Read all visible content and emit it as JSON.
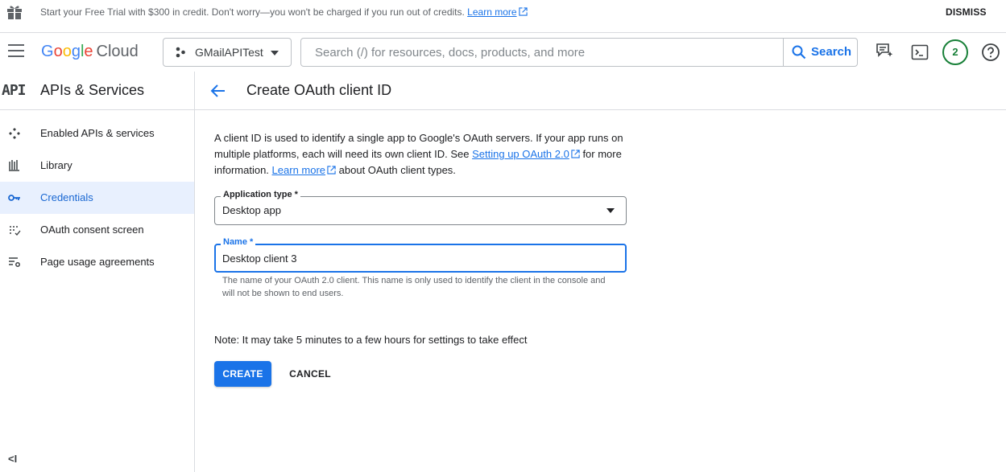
{
  "banner": {
    "message": "Start your Free Trial with $300 in credit. Don't worry—you won't be charged if you run out of credits.",
    "learn_more": "Learn more",
    "dismiss": "DISMISS"
  },
  "topbar": {
    "logo_google": [
      "G",
      "o",
      "o",
      "g",
      "l",
      "e"
    ],
    "logo_cloud": "Cloud",
    "project_name": "GMailAPITest",
    "search_placeholder": "Search (/) for resources, docs, products, and more",
    "search_button": "Search",
    "notification_count": "2"
  },
  "sidebar": {
    "api_glyph": "API",
    "title": "APIs & Services",
    "items": [
      {
        "label": "Enabled APIs & services",
        "icon": "diamond-arrows-icon",
        "active": false
      },
      {
        "label": "Library",
        "icon": "library-icon",
        "active": false
      },
      {
        "label": "Credentials",
        "icon": "key-icon",
        "active": true
      },
      {
        "label": "OAuth consent screen",
        "icon": "consent-grid-icon",
        "active": false
      },
      {
        "label": "Page usage agreements",
        "icon": "settings-list-icon",
        "active": false
      }
    ],
    "collapse_glyph": "<I"
  },
  "main": {
    "title": "Create OAuth client ID",
    "intro_part1": "A client ID is used to identify a single app to Google's OAuth servers. If your app runs on multiple platforms, each will need its own client ID. See",
    "intro_link1": "Setting up OAuth 2.0",
    "intro_part2": "for more information.",
    "intro_link2": "Learn more",
    "intro_part3": "about OAuth client types.",
    "app_type_label": "Application type *",
    "app_type_value": "Desktop app",
    "name_label": "Name *",
    "name_value": "Desktop client 3",
    "name_helper": "The name of your OAuth 2.0 client. This name is only used to identify the client in the console and will not be shown to end users.",
    "note": "Note: It may take 5 minutes to a few hours for settings to take effect",
    "create_button": "CREATE",
    "cancel_button": "CANCEL"
  },
  "colors": {
    "accent": "#1a73e8",
    "active_nav_bg": "#e8f0fe",
    "badge_green": "#188038"
  }
}
